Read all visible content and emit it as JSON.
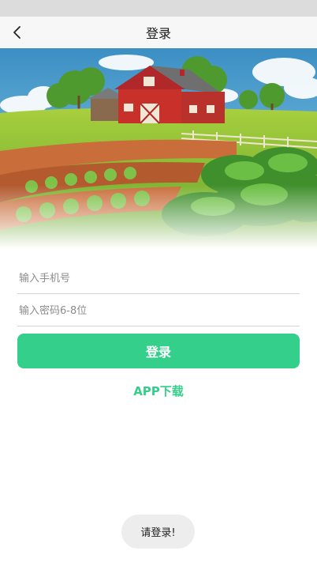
{
  "nav": {
    "title": "登录"
  },
  "form": {
    "phone_placeholder": "输入手机号",
    "password_placeholder": "输入密码6-8位",
    "login_label": "登录"
  },
  "app_download_label": "APP下载",
  "toast": "请登录!",
  "colors": {
    "accent": "#34cf8a",
    "status_bar": "#dcdcdc",
    "nav_bg": "#f7f7f7"
  },
  "icons": {
    "back": "chevron-left-icon"
  },
  "hero": {
    "image": "farm-barn-illustration"
  }
}
